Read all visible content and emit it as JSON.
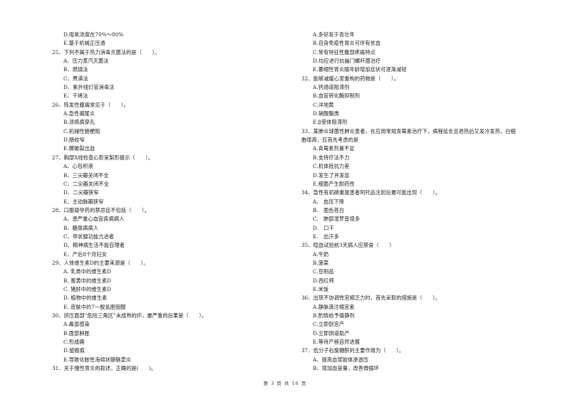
{
  "left_column": [
    {
      "type": "opt",
      "text": "D.吸氧浓度在70%～80%"
    },
    {
      "type": "opt",
      "text": "E.基于机械正压通"
    },
    {
      "type": "q",
      "text": "25、下列不属于热力消毒灭菌法的是（　　）。"
    },
    {
      "type": "opt",
      "text": "A、压力蒸汽灭菌法"
    },
    {
      "type": "opt",
      "text": "B、燃烧法"
    },
    {
      "type": "opt",
      "text": "C、煮沸法"
    },
    {
      "type": "opt",
      "text": "D、紫外线灯管消毒法"
    },
    {
      "type": "opt",
      "text": "E、干烤法"
    },
    {
      "type": "q",
      "text": "26、阵发性腹痛常见于（　　）。"
    },
    {
      "type": "opt",
      "text": "A.急性阑尾炎"
    },
    {
      "type": "opt",
      "text": "B.溃疡病穿孔"
    },
    {
      "type": "opt",
      "text": "C.机械性肠梗阻"
    },
    {
      "type": "opt",
      "text": "D.肠绞窄"
    },
    {
      "type": "opt",
      "text": "E.脾破裂出血"
    },
    {
      "type": "q",
      "text": "27、胸部X线检查心影呈梨形提示（　　）。"
    },
    {
      "type": "opt",
      "text": "A、心包积液"
    },
    {
      "type": "opt",
      "text": "B、三尖瓣关闭不全"
    },
    {
      "type": "opt",
      "text": "C、二尖瓣关闭不全"
    },
    {
      "type": "opt",
      "text": "D、二尖瓣狭窄"
    },
    {
      "type": "opt",
      "text": "E、主动脉瓣狭窄"
    },
    {
      "type": "q",
      "text": "28、口服避孕药的禁忌症不包括（　　）。"
    },
    {
      "type": "opt",
      "text": "A、患严重心血管疾病病人"
    },
    {
      "type": "opt",
      "text": "B、糖尿病病人"
    },
    {
      "type": "opt",
      "text": "C、甲状腺功能亢进者"
    },
    {
      "type": "opt",
      "text": "D、精神病生活不能自理者"
    },
    {
      "type": "opt",
      "text": "E、产后8个月妇女"
    },
    {
      "type": "q",
      "text": "29、人体维生素D的主要来源是（　　）。"
    },
    {
      "type": "opt",
      "text": "A. 乳类中的维生素D"
    },
    {
      "type": "opt",
      "text": "B. 蛋黄中的维生素D"
    },
    {
      "type": "opt",
      "text": "C. 猪肝中的维生素D"
    },
    {
      "type": "opt",
      "text": "D. 植物中的维生素"
    },
    {
      "type": "opt",
      "text": "E. 皮肤中的7一脱氢胆固醇"
    },
    {
      "type": "q",
      "text": "30、挤压面部“危险三角区”未成熟的疖，最严重的后果是（　　）。"
    },
    {
      "type": "opt",
      "text": "A.鼻部感染"
    },
    {
      "type": "opt",
      "text": "B.面部肿胀"
    },
    {
      "type": "opt",
      "text": "C.形成痈"
    },
    {
      "type": "opt",
      "text": "D.留瘢痕"
    },
    {
      "type": "opt",
      "text": "E.导致化脓性海绵状静脉窦炎"
    },
    {
      "type": "q",
      "text": "31、关于慢性胃炎的叙述，正确的是(　　)。"
    }
  ],
  "right_column": [
    {
      "type": "opt",
      "text": "A.多好发于青壮年"
    },
    {
      "type": "opt",
      "text": "B.自身免疫性胃炎可伴有贫血"
    },
    {
      "type": "opt",
      "text": "C.常有特征性腹部疼痛特点"
    },
    {
      "type": "opt",
      "text": "D.均应进行抗幽门螺杆菌治疗"
    },
    {
      "type": "opt",
      "text": "E.萎缩性胃炎随年龄增加症状可逐渐减轻"
    },
    {
      "type": "q",
      "text": "32、能够减缓心室重构的药物是（　　）。"
    },
    {
      "type": "opt",
      "text": "A.钙通道阻滞剂"
    },
    {
      "type": "opt",
      "text": "B.血管转化酶抑制剂"
    },
    {
      "type": "opt",
      "text": "C.洋地黄"
    },
    {
      "type": "opt",
      "text": "D.硝酸酯类"
    },
    {
      "type": "opt",
      "text": "E.β受体阻滞剂"
    },
    {
      "type": "q",
      "text": "33、某肺炎球菌性肺炎患者，在应用常规青霉素治疗下，病程延长且退热后又发冷发热，白细"
    },
    {
      "type": "q",
      "text": "胞增高，应首先考虑的是"
    },
    {
      "type": "opt",
      "text": "A.青霉素剂量不足"
    },
    {
      "type": "opt",
      "text": "B.支持疗法不力"
    },
    {
      "type": "opt",
      "text": "C.机体抵抗力差"
    },
    {
      "type": "opt",
      "text": "D.发生了并发症"
    },
    {
      "type": "opt",
      "text": "E.细菌产生耐药性"
    },
    {
      "type": "q",
      "text": "34、急性有机磷重度患者阿托品注射后最可能出现（　　）。"
    },
    {
      "type": "opt",
      "text": "A.　血压下降"
    },
    {
      "type": "opt",
      "text": "B.　面色苍白"
    },
    {
      "type": "opt",
      "text": "C.　肺部湿罗音增多"
    },
    {
      "type": "opt",
      "text": "D.　口干"
    },
    {
      "type": "opt",
      "text": "E.　出汗多"
    },
    {
      "type": "q",
      "text": "35、隐血试验前3天病人应禁食（　　）"
    },
    {
      "type": "opt",
      "text": "A.牛奶"
    },
    {
      "type": "opt",
      "text": "B.菠菜"
    },
    {
      "type": "opt",
      "text": "C.豆制品"
    },
    {
      "type": "opt",
      "text": "D.西红柿"
    },
    {
      "type": "opt",
      "text": "E.米饭"
    },
    {
      "type": "q",
      "text": "36、出现不协调性宫缩乏力时，首先采取的措施是（　　）。"
    },
    {
      "type": "opt",
      "text": "A.静脉滴注缩宫素"
    },
    {
      "type": "opt",
      "text": "B.酌情给予镇静剂"
    },
    {
      "type": "opt",
      "text": "C.立即剖宫产"
    },
    {
      "type": "opt",
      "text": "D.立即阴道助产"
    },
    {
      "type": "opt",
      "text": "E.等待产程自然进展"
    },
    {
      "type": "q",
      "text": "37、低分子右旋糖酐的主要作用为（　　）。"
    },
    {
      "type": "opt",
      "text": "A、提高血浆胶体渗透压"
    },
    {
      "type": "opt",
      "text": "B、增加血容量，改善微循环"
    }
  ],
  "footer": {
    "page_label": "第 3 页 共 16 页"
  }
}
